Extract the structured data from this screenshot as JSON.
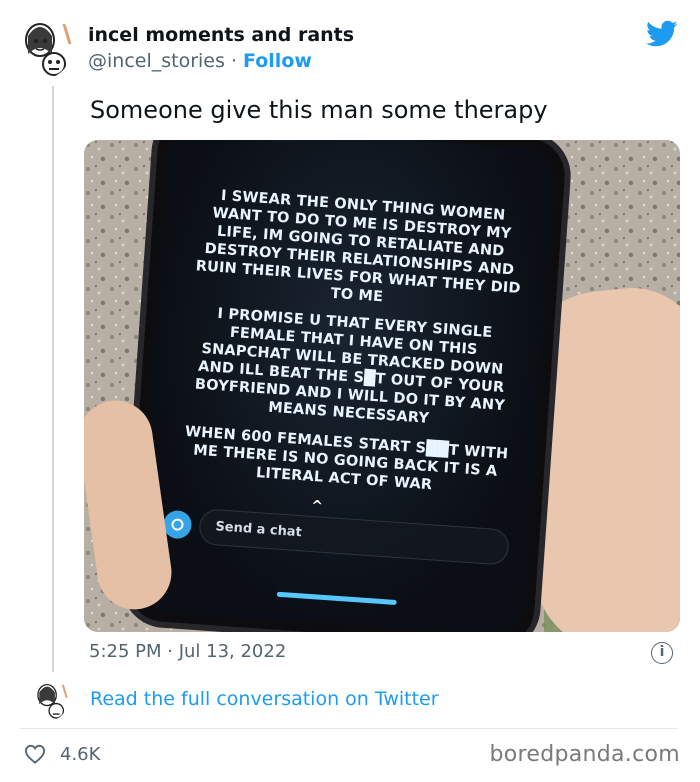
{
  "tweet": {
    "display_name": "incel moments and rants",
    "handle": "@incel_stories",
    "separator": "·",
    "follow_label": "Follow",
    "text": "Someone give this man some therapy",
    "timestamp": "5:25 PM · Jul 13, 2022",
    "info_icon": "i",
    "read_link": "Read the full conversation on Twitter",
    "like_count": "4.6K"
  },
  "media": {
    "snap_block_1": "I SWEAR THE ONLY THING WOMEN WANT TO DO TO ME IS DESTROY MY LIFE, IM GOING TO RETALIATE AND DESTROY THEIR RELATIONSHIPS AND RUIN THEIR LIVES FOR WHAT THEY DID TO ME",
    "snap_block_2": "I PROMISE U THAT EVERY SINGLE FEMALE THAT I HAVE ON THIS SNAPCHAT WILL BE TRACKED DOWN AND ILL BEAT THE S█T OUT OF YOUR BOYFRIEND AND I WILL DO IT BY ANY MEANS NECESSARY",
    "snap_block_3": "WHEN 600 FEMALES START S██T WITH ME THERE IS NO GOING BACK IT IS A LITERAL ACT OF WAR",
    "chat_placeholder": "Send a chat",
    "chevron": "^"
  },
  "footer": {
    "watermark": "boredpanda.com"
  },
  "icons": {
    "bird": "twitter-bird-icon",
    "heart": "heart-icon",
    "info": "info-icon",
    "camera": "camera-icon"
  },
  "colors": {
    "accent": "#1d9bf0",
    "text": "#0f1419",
    "muted": "#536471",
    "line": "#cfd9de"
  }
}
